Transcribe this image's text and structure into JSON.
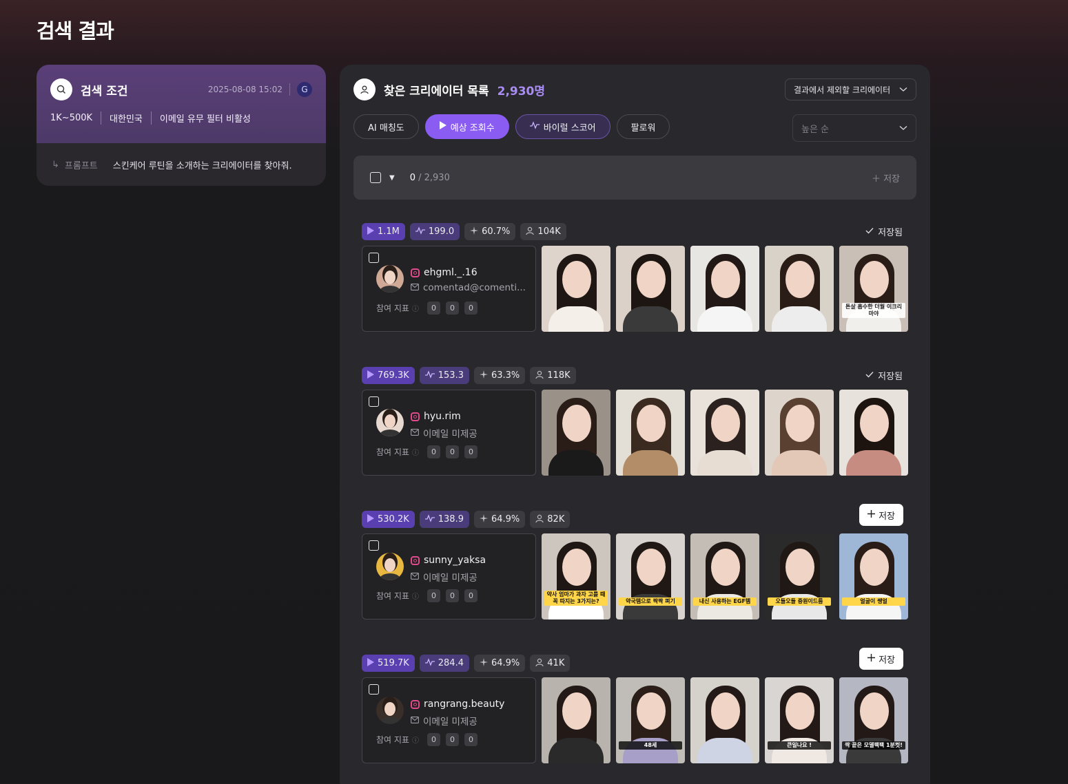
{
  "page": {
    "title": "검색 결과"
  },
  "search": {
    "title": "검색 조건",
    "date": "2025-08-08 15:02",
    "user_initial": "G",
    "filters": [
      "1K~500K",
      "대한민국",
      "이메일 유무 필터 비활성"
    ],
    "prompt_label": "프롬프트",
    "prompt_text": "스킨케어 루틴을 소개하는 크리에이터를 찾아줘."
  },
  "results": {
    "title": "찾은 크리에이터 목록",
    "count": "2,930명",
    "exclude_label": "결과에서 제외할 크리에이터",
    "tabs": [
      "AI 매칭도",
      "예상 조회수",
      "바이럴 스코어",
      "팔로워"
    ],
    "sort_label": "높은 순",
    "selected": "0",
    "total": " / 2,930",
    "save_all": "저장"
  },
  "creators": [
    {
      "views": "1.1M",
      "viral": "199.0",
      "engagement": "60.7%",
      "followers": "104K",
      "status": "저장됨",
      "handle": "ehgml._.16",
      "email": "comentad@comenti...",
      "metrics_label": "참여 지표",
      "metrics": [
        "0",
        "0",
        "0"
      ],
      "thumb_captions": [
        "",
        "",
        "",
        "",
        "튼살 흡수한 더월 이크리마야"
      ]
    },
    {
      "views": "769.3K",
      "viral": "153.3",
      "engagement": "63.3%",
      "followers": "118K",
      "status": "저장됨",
      "handle": "hyu.rim",
      "email": "이메일 미제공",
      "metrics_label": "참여 지표",
      "metrics": [
        "0",
        "0",
        "0"
      ],
      "thumb_captions": [
        "",
        "",
        "",
        "",
        ""
      ]
    },
    {
      "views": "530.2K",
      "viral": "138.9",
      "engagement": "64.9%",
      "followers": "82K",
      "status": "저장",
      "handle": "sunny_yaksa",
      "email": "이메일 미제공",
      "metrics_label": "참여 지표",
      "metrics": [
        "0",
        "0",
        "0"
      ],
      "thumb_captions": [
        "약사 엄마가 과자 고를 때 꼭 따지는 3가지는?",
        "약국템으로 짝짝 펴기",
        "내신 사용하는 EGF템",
        "오들오들 증원이드름",
        "얼굴이 쌩얼"
      ]
    },
    {
      "views": "519.7K",
      "viral": "284.4",
      "engagement": "64.9%",
      "followers": "41K",
      "status": "저장",
      "handle": "rangrang.beauty",
      "email": "이메일 미제공",
      "metrics_label": "참여 지표",
      "metrics": [
        "0",
        "0",
        "0"
      ],
      "thumb_captions": [
        "",
        "48세",
        "",
        "큰일나요 !",
        "싹 끝은 모델팩팩 1분컷!"
      ]
    }
  ],
  "icons": {
    "search": "search-icon",
    "user": "user-icon",
    "play": "play-icon",
    "viral": "activity-icon",
    "sparkle": "sparkle-icon",
    "person": "person-icon",
    "check": "check-icon",
    "plus": "plus-icon",
    "chevron": "chevron-down-icon",
    "instagram": "instagram-icon",
    "mail": "mail-icon",
    "info": "info-icon"
  },
  "colors": {
    "accent": "#8a5cf2",
    "count": "#a98cf5",
    "views_pill": "#5a3fb0",
    "viral_pill": "#4a3c7a"
  }
}
